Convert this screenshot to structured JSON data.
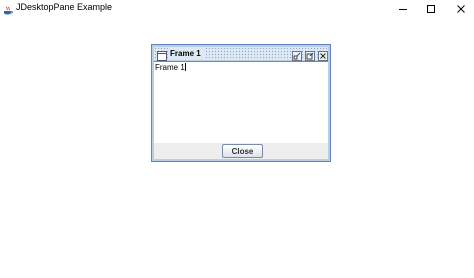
{
  "window": {
    "title": "JDesktopPane Example",
    "app_icon": "java-icon",
    "controls": [
      "minimize-icon",
      "maximize-icon",
      "close-icon"
    ]
  },
  "internal_frame": {
    "title": "Frame 1",
    "frame_icon": "window-icon",
    "controls": [
      "iconify-icon",
      "maximize-icon",
      "close-icon"
    ],
    "content_text": "Frame 1",
    "close_button_label": "Close"
  },
  "colors": {
    "frame_border": "#6382bf",
    "frame_bg": "#b8cfe5",
    "title_dots": "#8aa6cf",
    "button_panel": "#eeeeee"
  }
}
